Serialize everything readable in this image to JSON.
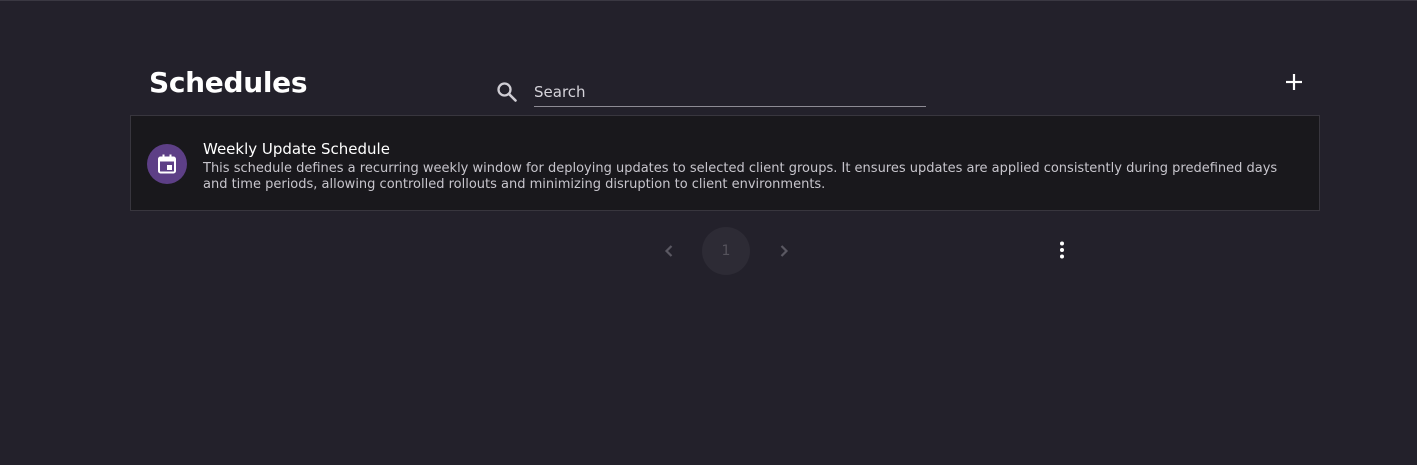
{
  "header": {
    "title": "Schedules"
  },
  "search": {
    "placeholder": "Search",
    "value": "",
    "icon": "search-icon"
  },
  "actions": {
    "add_icon": "plus-icon"
  },
  "schedules": [
    {
      "name": "Weekly Update Schedule",
      "description": "This schedule defines a recurring weekly window for deploying updates to selected client groups. It ensures updates are applied consistently during predefined days and time periods, allowing controlled rollouts and minimizing disruption to client environments.",
      "icon": "calendar-icon"
    }
  ],
  "pagination": {
    "current_page": "1",
    "prev_icon": "chevron-left-icon",
    "next_icon": "chevron-right-icon",
    "more_icon": "more-vertical-icon"
  },
  "colors": {
    "background": "#23212b",
    "card": "#19181c",
    "avatar": "#5d3f86"
  }
}
